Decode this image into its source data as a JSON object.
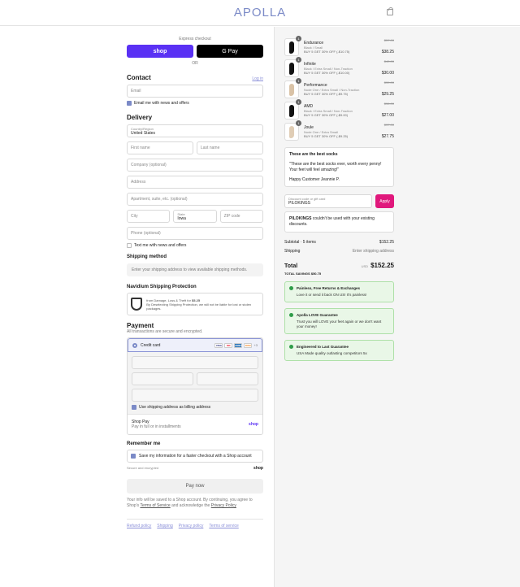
{
  "brand": "APOLLA",
  "express": {
    "label": "Express checkout",
    "shop": "shop",
    "gpay": "G Pay",
    "or": "OR"
  },
  "contact": {
    "title": "Contact",
    "login": "Log in",
    "email_ph": "Email",
    "news": "Email me with news and offers"
  },
  "delivery": {
    "title": "Delivery",
    "country_label": "Country/Region",
    "country": "United States",
    "first": "First name",
    "last": "Last name",
    "company": "Company (optional)",
    "address": "Address",
    "apt": "Apartment, suite, etc. (optional)",
    "city": "City",
    "state_label": "State",
    "state": "Iowa",
    "zip": "ZIP code",
    "phone": "Phone (optional)",
    "text_news": "Text me with news and offers"
  },
  "shipping": {
    "title": "Shipping method",
    "msg": "Enter your shipping address to view available shipping methods."
  },
  "navidium": {
    "title": "Navidium Shipping Protection",
    "line1": "from Damage, Loss & Theft for",
    "price": "$5.25",
    "line2": "By Deselecting Shipping Protection, we will not be liable for lost or stolen packages."
  },
  "payment": {
    "title": "Payment",
    "sub": "All transactions are secure and encrypted.",
    "cc": "Credit card",
    "cards": [
      "VISA",
      "MC",
      "AMEX",
      "DISC"
    ],
    "more": "+3",
    "billing": "Use shipping address as billing address",
    "shoppay": "Shop Pay",
    "shoppay_sub": "Pay in full or in installments",
    "shoppay_logo": "shop"
  },
  "remember": {
    "title": "Remember me",
    "label": "Save my information for a faster checkout with a Shop account",
    "secure": "Secure and encrypted",
    "logo": "shop"
  },
  "paynow": "Pay now",
  "legal": {
    "text": "Your info will be saved to a Shop account. By continuing, you agree to Shop's",
    "tos": "Terms of Service",
    "and": "and acknowledge the",
    "pp": "Privacy Policy"
  },
  "footer": [
    "Refund policy",
    "Shipping",
    "Privacy policy",
    "Terms of service"
  ],
  "items": [
    {
      "name": "Endurance",
      "variant": "Black / Small",
      "promo": "BUY 5 GET 30% OFF (-$10.75)",
      "old": "$57.00",
      "price": "$38.25",
      "qty": "1",
      "color": "#111"
    },
    {
      "name": "Infinite",
      "variant": "Black / Extra Small / Non-Traction",
      "promo": "BUY 5 GET 30% OFF (-$10.00)",
      "old": "$40.00",
      "price": "$30.00",
      "qty": "1",
      "color": "#111"
    },
    {
      "name": "Performance",
      "variant": "Nude One / Extra Small / Non-Traction",
      "promo": "BUY 5 GET 30% OFF (-$9.75)",
      "old": "$39.00",
      "price": "$29.25",
      "qty": "1",
      "color": "#d9c2a6"
    },
    {
      "name": "AMD",
      "variant": "Black / Extra Small / Non-Traction",
      "promo": "BUY 5 GET 30% OFF (-$9.00)",
      "old": "$36.00",
      "price": "$27.00",
      "qty": "1",
      "color": "#111"
    },
    {
      "name": "Joule",
      "variant": "Nude One / Extra Small",
      "promo": "BUY 5 GET 30% OFF (-$9.25)",
      "old": "$37.00",
      "price": "$27.75",
      "qty": "1",
      "color": "#e0cdb5"
    }
  ],
  "review": {
    "title": "These are the best socks",
    "body": "\"These are the best socks ever, worth every penny! Your feet will feel amazing!\"",
    "author": "Happy Customer Jeannie P."
  },
  "discount": {
    "label": "Discount code or gift card",
    "value": "PILOKINGS",
    "apply": "Apply",
    "err_code": "PILOKINGS",
    "err": "couldn't be used with your existing discounts."
  },
  "summary": {
    "subtotal_label": "Subtotal · 5 items",
    "subtotal": "$152.25",
    "ship_label": "Shipping",
    "ship": "Enter shipping address",
    "total_label": "Total",
    "currency": "USD",
    "total": "$152.25",
    "savings_label": "TOTAL SAVINGS",
    "savings": "$50.75"
  },
  "guarantees": [
    {
      "title": "Painless, Free Returns & Exchanges",
      "body": "Love it or send it back ON US! It's painless!"
    },
    {
      "title": "Apolla LOVE Guarantee",
      "body": "Trust you will LOVE your feet again or we don't want your money!"
    },
    {
      "title": "Engineered to Last Guarantee",
      "body": "USA Made quality outlasting competitors 5x"
    }
  ]
}
